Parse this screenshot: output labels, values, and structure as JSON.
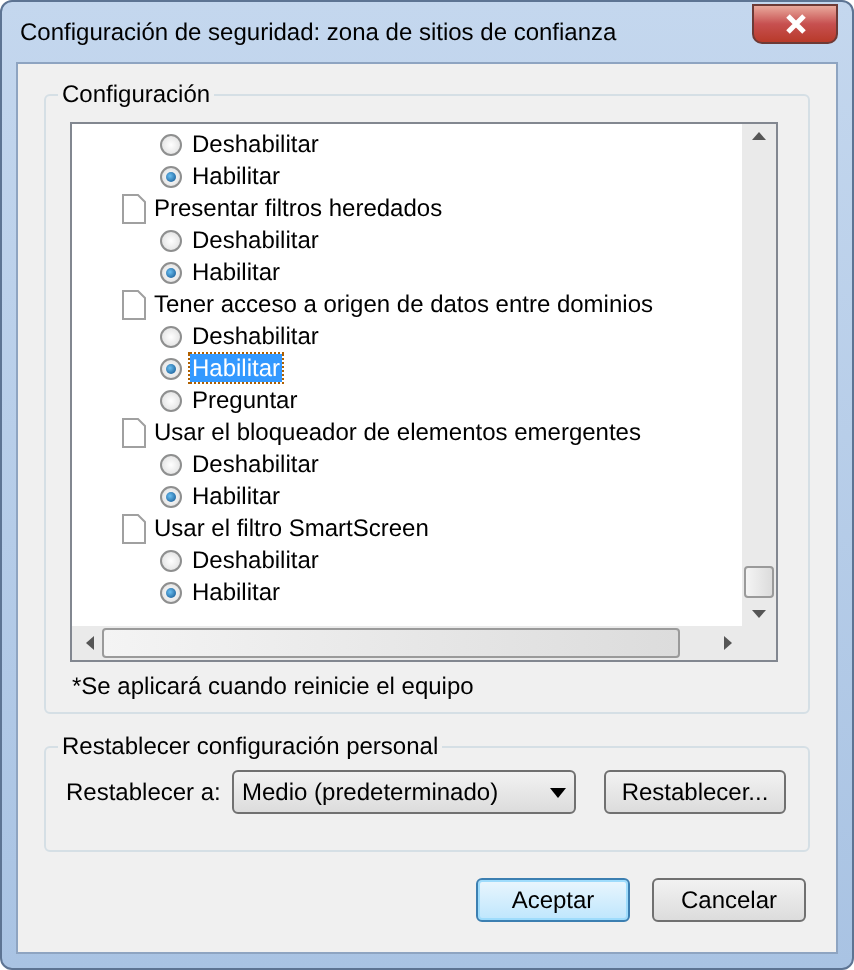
{
  "window": {
    "title": "Configuración de seguridad: zona de sitios de confianza"
  },
  "settings_group": {
    "title": "Configuración",
    "items": [
      {
        "options": [
          {
            "label": "Deshabilitar",
            "selected": false,
            "highlighted": false
          },
          {
            "label": "Habilitar",
            "selected": true,
            "highlighted": false
          }
        ]
      },
      {
        "label": "Presentar filtros heredados",
        "options": [
          {
            "label": "Deshabilitar",
            "selected": false,
            "highlighted": false
          },
          {
            "label": "Habilitar",
            "selected": true,
            "highlighted": false
          }
        ]
      },
      {
        "label": "Tener acceso a origen de datos entre dominios",
        "options": [
          {
            "label": "Deshabilitar",
            "selected": false,
            "highlighted": false
          },
          {
            "label": "Habilitar",
            "selected": true,
            "highlighted": true
          },
          {
            "label": "Preguntar",
            "selected": false,
            "highlighted": false
          }
        ]
      },
      {
        "label": "Usar el bloqueador de elementos emergentes",
        "options": [
          {
            "label": "Deshabilitar",
            "selected": false,
            "highlighted": false
          },
          {
            "label": "Habilitar",
            "selected": true,
            "highlighted": false
          }
        ]
      },
      {
        "label": "Usar el filtro SmartScreen",
        "options": [
          {
            "label": "Deshabilitar",
            "selected": false,
            "highlighted": false
          },
          {
            "label": "Habilitar",
            "selected": true,
            "highlighted": false
          }
        ]
      }
    ],
    "note": "*Se aplicará cuando reinicie el equipo"
  },
  "reset_group": {
    "title": "Restablecer configuración personal",
    "label": "Restablecer a:",
    "dropdown_value": "Medio (predeterminado)",
    "button": "Restablecer..."
  },
  "buttons": [
    {
      "label": "Aceptar",
      "default": true
    },
    {
      "label": "Cancelar",
      "default": false
    }
  ]
}
